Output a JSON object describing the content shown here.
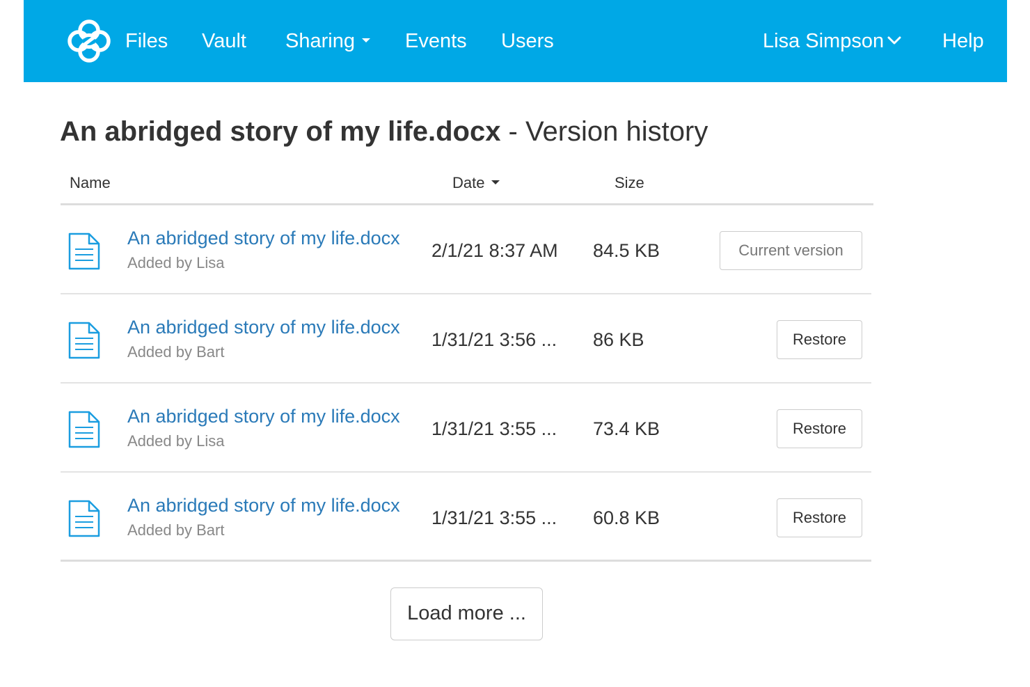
{
  "navbar": {
    "logo_icon": "sync-logo-icon",
    "items": {
      "files": "Files",
      "vault": "Vault",
      "sharing": "Sharing",
      "events": "Events",
      "users": "Users"
    },
    "user_name": "Lisa Simpson",
    "help": "Help",
    "background_color": "#00a8e6"
  },
  "page": {
    "title_file": "An abridged story of my life.docx",
    "title_suffix": " - Version history"
  },
  "table": {
    "headers": {
      "name": "Name",
      "date": "Date",
      "size": "Size"
    },
    "sort_column": "Date",
    "rows": [
      {
        "name": "An abridged story of my life.docx",
        "added_prefix": "Added by ",
        "added_by": "Lisa",
        "date": "2/1/21 8:37 AM",
        "size": "84.5 KB",
        "action": "Current version",
        "is_current": true
      },
      {
        "name": "An abridged story of my life.docx",
        "added_prefix": "Added by ",
        "added_by": "Bart",
        "date": "1/31/21 3:56 ...",
        "size": "86 KB",
        "action": "Restore",
        "is_current": false
      },
      {
        "name": "An abridged story of my life.docx",
        "added_prefix": "Added by ",
        "added_by": "Lisa",
        "date": "1/31/21 3:55 ...",
        "size": "73.4 KB",
        "action": "Restore",
        "is_current": false
      },
      {
        "name": "An abridged story of my life.docx",
        "added_prefix": "Added by ",
        "added_by": "Bart",
        "date": "1/31/21 3:55 ...",
        "size": "60.8 KB",
        "action": "Restore",
        "is_current": false
      }
    ]
  },
  "load_more": "Load more ...",
  "colors": {
    "link": "#2a7ab8",
    "icon": "#1a9de0",
    "muted": "#888888"
  }
}
